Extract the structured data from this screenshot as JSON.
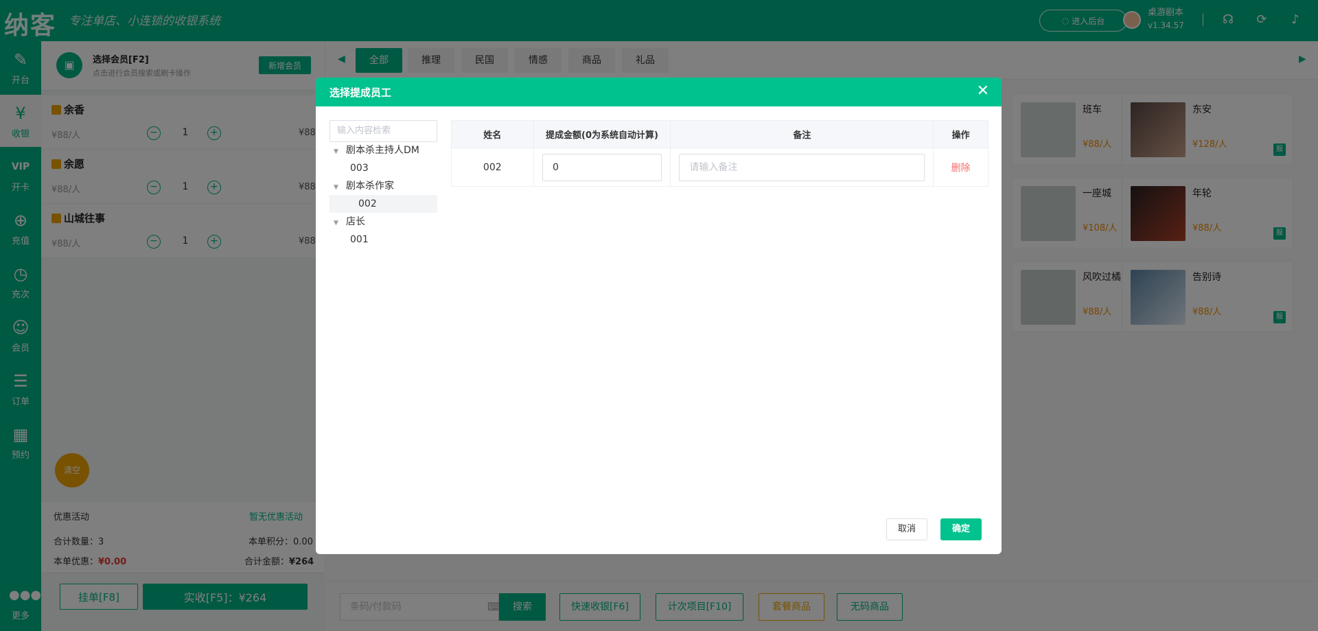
{
  "header": {
    "brand": "纳客",
    "slogan": "专注单店、小连锁的收银系统",
    "admin_button": "进入后台",
    "store_name": "桌游剧本",
    "version": "v1.34.57"
  },
  "nav": [
    {
      "label": "开台",
      "icon": "edit-icon"
    },
    {
      "label": "收银",
      "icon": "cashier-icon"
    },
    {
      "label": "开卡",
      "icon": "vip-card-icon"
    },
    {
      "label": "充值",
      "icon": "recharge-icon"
    },
    {
      "label": "充次",
      "icon": "recharge-times-icon"
    },
    {
      "label": "会员",
      "icon": "member-icon"
    },
    {
      "label": "订单",
      "icon": "order-icon"
    },
    {
      "label": "预约",
      "icon": "calendar-icon"
    },
    {
      "label": "更多",
      "icon": "more-icon"
    }
  ],
  "cart": {
    "member_title": "选择会员[F2]",
    "member_sub": "点击进行会员搜索或刷卡操作",
    "add_member": "新增会员",
    "items": [
      {
        "name": "余香",
        "price": "¥88/人",
        "qty": "1",
        "total": "¥88"
      },
      {
        "name": "余愿",
        "price": "¥88/人",
        "qty": "1",
        "total": "¥88"
      },
      {
        "name": "山城往事",
        "price": "¥88/人",
        "qty": "1",
        "total": "¥88"
      }
    ],
    "clear": "清空",
    "promo_label": "优惠活动",
    "promo_value": "暂无优惠活动",
    "total_qty_label": "合计数量：",
    "total_qty": "3",
    "points_label": "本单积分：",
    "points": "0.00",
    "discount_label": "本单优惠：",
    "discount": "¥0.00",
    "amount_label": "合计金额：",
    "amount": "¥264",
    "hold_button": "挂单[F8]",
    "pay_button": "实收[F5]：¥264"
  },
  "categories": [
    "全部",
    "推理",
    "民国",
    "情感",
    "商品",
    "礼品"
  ],
  "products": [
    {
      "name": "班车",
      "price": "¥88/人",
      "tag": "服"
    },
    {
      "name": "东安",
      "price": "¥128/人",
      "tag": "服"
    },
    {
      "name": "一座城",
      "price": "¥108/人",
      "tag": "服"
    },
    {
      "name": "年轮",
      "price": "¥88/人",
      "tag": "服"
    },
    {
      "name": "风吹过橘色的海",
      "price": "¥88/人",
      "tag": "服"
    },
    {
      "name": "告别诗",
      "price": "¥88/人",
      "tag": "服"
    }
  ],
  "bottom": {
    "code_placeholder": "条码/付款码",
    "search": "搜索",
    "quick_cash": "快速收银[F6]",
    "count_items": "计次项目[F10]",
    "package": "套餐商品",
    "no_code": "无码商品"
  },
  "modal": {
    "title": "选择提成员工",
    "search_placeholder": "输入内容检索",
    "tree": [
      {
        "label": "剧本杀主持人DM",
        "children": [
          "003"
        ]
      },
      {
        "label": "剧本杀作家",
        "children": [
          "002"
        ]
      },
      {
        "label": "店长",
        "children": [
          "001"
        ]
      }
    ],
    "columns": [
      "姓名",
      "提成金额(0为系统自动计算)",
      "备注",
      "操作"
    ],
    "rows": [
      {
        "name": "002",
        "amount": "0",
        "note_placeholder": "请输入备注",
        "action": "删除"
      }
    ],
    "cancel": "取消",
    "confirm": "确定"
  },
  "colors": {
    "brand": "#00b386",
    "modal_header": "#00c28e",
    "accent_orange": "#f0a500",
    "danger": "#f56c6c"
  }
}
